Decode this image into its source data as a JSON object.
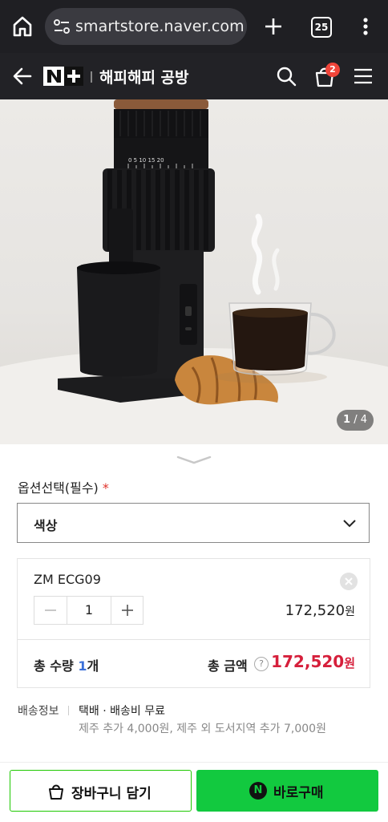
{
  "browser": {
    "url": "smartstore.naver.com",
    "tab_count": "25"
  },
  "header": {
    "logo_text": "N+",
    "store_name": "해피해피 공방",
    "cart_badge": "2"
  },
  "hero": {
    "page_current": "1",
    "page_total": "/ 4",
    "dial_scale": "0  5  10  15  20"
  },
  "option": {
    "section_label": "옵션선택(필수)",
    "required_mark": "*",
    "select_value": "색상"
  },
  "selected_item": {
    "name": "ZM ECG09",
    "quantity": "1",
    "price": "172,520",
    "price_unit": "원",
    "total_qty_label": "총 수량 ",
    "total_qty_value": "1",
    "total_qty_unit": "개",
    "total_amount_label": "총 금액",
    "help_mark": "?",
    "total_amount": "172,520",
    "total_unit": "원"
  },
  "shipping": {
    "label": "배송정보",
    "main": "택배 · 배송비 무료",
    "sub": "제주 추가 4,000원, 제주 외 도서지역 추가 7,000원"
  },
  "actions": {
    "cart_label": "장바구니 담기",
    "buy_icon_text": "N",
    "buy_label": "바로구매"
  },
  "colors": {
    "accent_green": "#12c93f",
    "price_red": "#d61f3b",
    "badge_red": "#f0453a"
  }
}
